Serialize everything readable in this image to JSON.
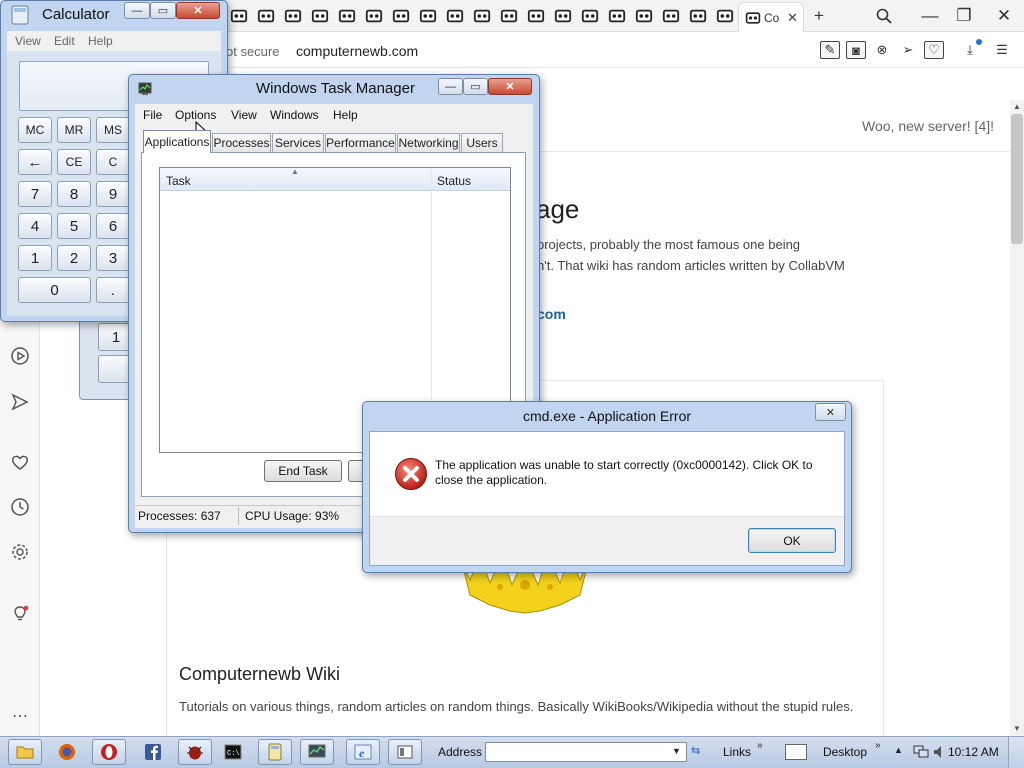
{
  "browser": {
    "active_tab_title": "Co",
    "active_tab_close": "✕",
    "new_tab": "+",
    "search": "⚲",
    "minimize": "—",
    "restore": "❐",
    "close": "✕",
    "security": "ot secure",
    "url": "computernewb.com",
    "favicon_icon": "computernewb-icon"
  },
  "page": {
    "header_notice": "Woo, new server! [4]!",
    "title_fragment": "age",
    "intro_line1": "projects, probably the most famous one being",
    "intro_line2": "n't. That wiki has random articles written by CollabVM",
    "link_fragment": "com",
    "wiki_title": "Computernewb Wiki",
    "wiki_description": "Tutorials on various things, random articles on random things. Basically WikiBooks/Wikipedia without the stupid rules."
  },
  "calculator": {
    "title": "Calculator",
    "menu": [
      "View",
      "Edit",
      "Help"
    ],
    "memory_row": [
      "MC",
      "MR",
      "MS"
    ],
    "clear_row": [
      "←",
      "CE",
      "C"
    ],
    "row1": [
      "7",
      "8",
      "9"
    ],
    "row2": [
      "4",
      "5",
      "6"
    ],
    "row3": [
      "1",
      "2",
      "3"
    ],
    "zero": "0",
    "decimal": ".",
    "background_key": "1"
  },
  "task_manager": {
    "title": "Windows Task Manager",
    "menu": [
      "File",
      "Options",
      "View",
      "Windows",
      "Help"
    ],
    "tabs": [
      "Applications",
      "Processes",
      "Services",
      "Performance",
      "Networking",
      "Users"
    ],
    "active_tab": "Applications",
    "columns": [
      "Task",
      "Status"
    ],
    "sort_indicator": "▲",
    "end_task": "End Task",
    "status_processes": "Processes: 637",
    "status_cpu": "CPU Usage: 93%"
  },
  "error_dialog": {
    "title": "cmd.exe - Application Error",
    "message": "The application was unable to start correctly (0xc0000142). Click OK to close the application.",
    "ok": "OK",
    "close": "✕"
  },
  "taskbar": {
    "address_label": "Address",
    "links_label": "Links",
    "desktop_label": "Desktop",
    "chevron": "»",
    "tray_up": "▲",
    "clock": "10:12 AM",
    "dropdown": "▼"
  }
}
